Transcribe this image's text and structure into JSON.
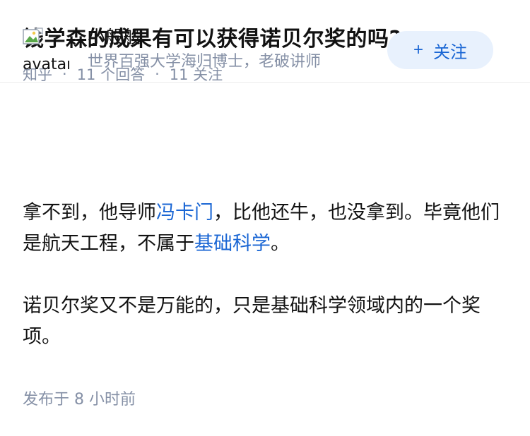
{
  "question": {
    "title": "钱学森的成果有可以获得诺贝尔奖的吗?",
    "source": "知乎",
    "separator": "·",
    "answers_count": "11 个回答",
    "followers_count": "11 关注"
  },
  "answer": {
    "author": {
      "name": "小般般",
      "bio": "世界百强大学海归博士，老破讲师",
      "avatar_alt": "avatar"
    },
    "follow_button": {
      "icon": "+",
      "label": "关注"
    },
    "paragraph1": {
      "part1": "拿不到，他导师",
      "link1": "冯卡门",
      "part2": "，比他还牛，也没拿到。毕竟他们是航天工程，不属于",
      "link2": "基础科学",
      "part3": "。"
    },
    "paragraph2": {
      "text": "诺贝尔奖又不是万能的，只是基础科学领域内的一个奖项。"
    },
    "publish_time": "发布于 8 小时前"
  },
  "colors": {
    "link": "#1a66d4",
    "meta": "#8590a6",
    "follow_bg": "#e8f1fd"
  }
}
